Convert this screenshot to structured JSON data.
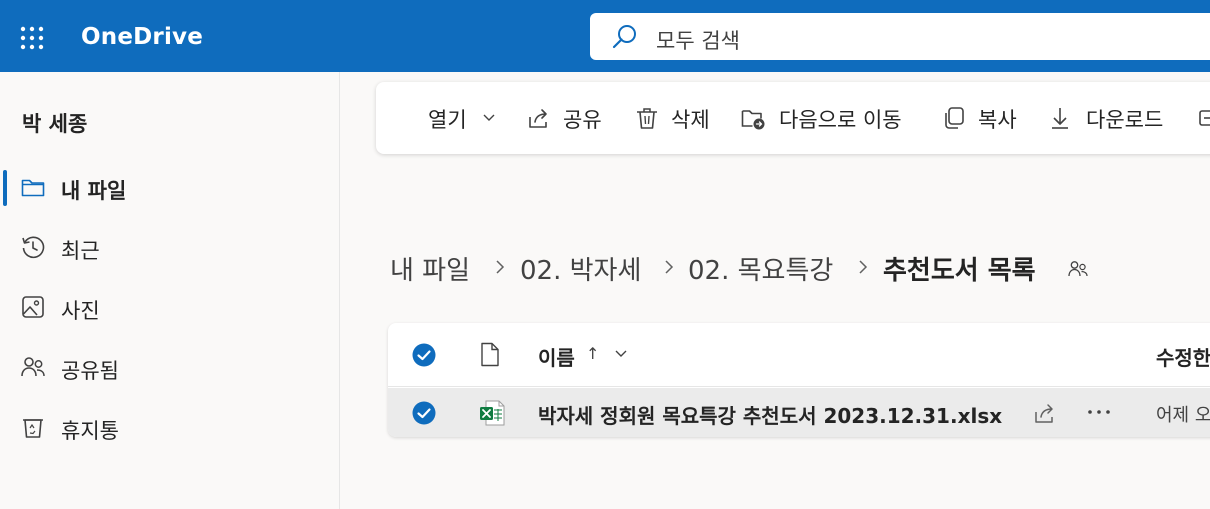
{
  "header": {
    "app_title": "OneDrive",
    "search_placeholder": "모두 검색",
    "brand_color": "#0f6cbd"
  },
  "sidebar": {
    "user_name": "박 세종",
    "items": [
      {
        "label": "내 파일",
        "icon": "folder-icon",
        "active": true
      },
      {
        "label": "최근",
        "icon": "history-icon",
        "active": false
      },
      {
        "label": "사진",
        "icon": "image-icon",
        "active": false
      },
      {
        "label": "공유됨",
        "icon": "people-icon",
        "active": false
      },
      {
        "label": "휴지통",
        "icon": "recycle-bin-icon",
        "active": false
      }
    ]
  },
  "commands": [
    {
      "label": "열기",
      "icon": "chevron-down-icon"
    },
    {
      "label": "공유",
      "icon": "share-icon"
    },
    {
      "label": "삭제",
      "icon": "trash-icon"
    },
    {
      "label": "다음으로 이동",
      "icon": "move-folder-icon"
    },
    {
      "label": "복사",
      "icon": "copy-icon"
    },
    {
      "label": "다운로드",
      "icon": "download-icon"
    }
  ],
  "breadcrumb": {
    "items": [
      "내 파일",
      "02. 박자세",
      "02. 목요특강",
      "추천도서 목록"
    ],
    "current_icon": "shared-people-icon"
  },
  "file_list": {
    "columns": {
      "name": "이름",
      "name_sort": "↑",
      "modified": "수정한"
    },
    "rows": [
      {
        "name": "박자세 정회원 목요특강 추천도서 2023.12.31.xlsx",
        "modified": "어제 오",
        "file_type": "excel-icon",
        "selected": true
      }
    ]
  }
}
